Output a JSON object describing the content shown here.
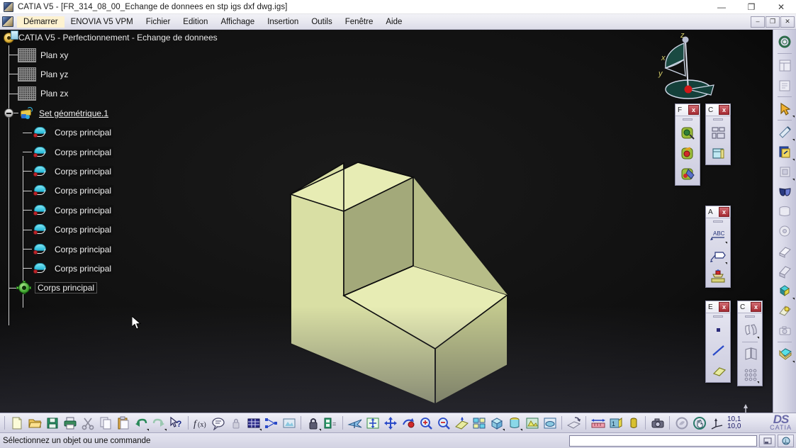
{
  "window": {
    "title": "CATIA V5 - [FR_314_08_00_Echange de donnees en stp igs dxf dwg.igs]",
    "minimize": "—",
    "maximize": "❐",
    "close": "✕",
    "inner_minimize": "–",
    "inner_restore": "❐",
    "inner_close": "✕"
  },
  "menubar": {
    "items": [
      {
        "label": "Démarrer",
        "name": "menu-demarrer",
        "active": true
      },
      {
        "label": "ENOVIA V5 VPM",
        "name": "menu-enovia",
        "active": false
      },
      {
        "label": "Fichier",
        "name": "menu-fichier",
        "active": false
      },
      {
        "label": "Edition",
        "name": "menu-edition",
        "active": false
      },
      {
        "label": "Affichage",
        "name": "menu-affichage",
        "active": false
      },
      {
        "label": "Insertion",
        "name": "menu-insertion",
        "active": false
      },
      {
        "label": "Outils",
        "name": "menu-outils",
        "active": false
      },
      {
        "label": "Fenêtre",
        "name": "menu-fenetre",
        "active": false
      },
      {
        "label": "Aide",
        "name": "menu-aide",
        "active": false
      }
    ]
  },
  "tree": {
    "root": "CATIA V5 - Perfectionnement - Echange de donnees",
    "planes": [
      "Plan xy",
      "Plan yz",
      "Plan zx"
    ],
    "geoset": "Set géométrique.1",
    "bodies": [
      "Corps principal",
      "Corps principal",
      "Corps principal",
      "Corps principal",
      "Corps principal",
      "Corps principal",
      "Corps principal",
      "Corps principal"
    ],
    "main_body": "Corps principal"
  },
  "compass": {
    "x_label": "x",
    "y_label": "y",
    "z_label": "z"
  },
  "floating_toolbars": [
    {
      "name": "toolbar-f",
      "title": "F",
      "close": "x",
      "buttons": [
        "heal-icon",
        "repair-icon",
        "fill-icon"
      ]
    },
    {
      "name": "toolbar-c-top",
      "title": "C",
      "close": "x",
      "buttons": [
        "layout-icon",
        "window-icon"
      ]
    },
    {
      "name": "toolbar-a",
      "title": "A",
      "close": "x",
      "buttons": [
        "abc-text-icon",
        "flag-note-icon",
        "stamp-icon"
      ]
    },
    {
      "name": "toolbar-e",
      "title": "E",
      "close": "x",
      "buttons": [
        "point-icon",
        "line-icon",
        "plane-icon"
      ]
    },
    {
      "name": "toolbar-c-bottom",
      "title": "C",
      "close": "x",
      "buttons": [
        "join-icon",
        "split-icon",
        "array-icon"
      ]
    }
  ],
  "right_toolbar": {
    "buttons": [
      "gear-icon",
      "catalog-icon",
      "measure-item-icon",
      "select-arrow-icon",
      "sketch-icon",
      "update-icon",
      "window-tile-icon",
      "glasses-icon",
      "cylinder-icon",
      "disc-icon",
      "shade-icon",
      "render-icon",
      "cube-axis-icon",
      "material-icon",
      "camera-icon",
      "layers-icon"
    ]
  },
  "bottom_toolbar": {
    "buttons": [
      "new-icon",
      "open-icon",
      "save-icon",
      "print-icon",
      "cut-icon",
      "copy-icon",
      "paste-icon",
      "undo-icon",
      "redo-icon",
      "what-is-this-icon",
      "formula-icon",
      "comment-icon",
      "lock-icon",
      "grid-icon",
      "relations-icon",
      "image-icon",
      "padlock-icon",
      "publication-icon",
      "fly-icon",
      "fit-all-icon",
      "pan-icon",
      "rotate-icon",
      "zoom-in-icon",
      "zoom-out-icon",
      "normal-view-icon",
      "multi-view-icon",
      "iso-view-icon",
      "render-style-icon",
      "hide-show-icon",
      "swap-visible-icon",
      "depth-effect-icon",
      "measure-between-icon",
      "measure-item-icon",
      "measure-inertia-icon",
      "capture-icon",
      "analyze-icon",
      "hand-pan-icon",
      "axis-icon"
    ],
    "coord_x": "10,1",
    "coord_y": "10,0",
    "logo_ds": "DS",
    "logo_text": "CATIA"
  },
  "statusbar": {
    "message": "Sélectionnez un objet ou une commande",
    "input_value": "",
    "buttons": [
      "minimize-panel-icon",
      "info-icon"
    ]
  },
  "model": {
    "name": "l-shaped-block",
    "face_top_color": "#e2e7ab",
    "face_left_color": "#d6dca0",
    "face_right_color": "#b5bb83",
    "face_dark_color": "#9aa06e",
    "edge_color": "#0d0d0d"
  }
}
